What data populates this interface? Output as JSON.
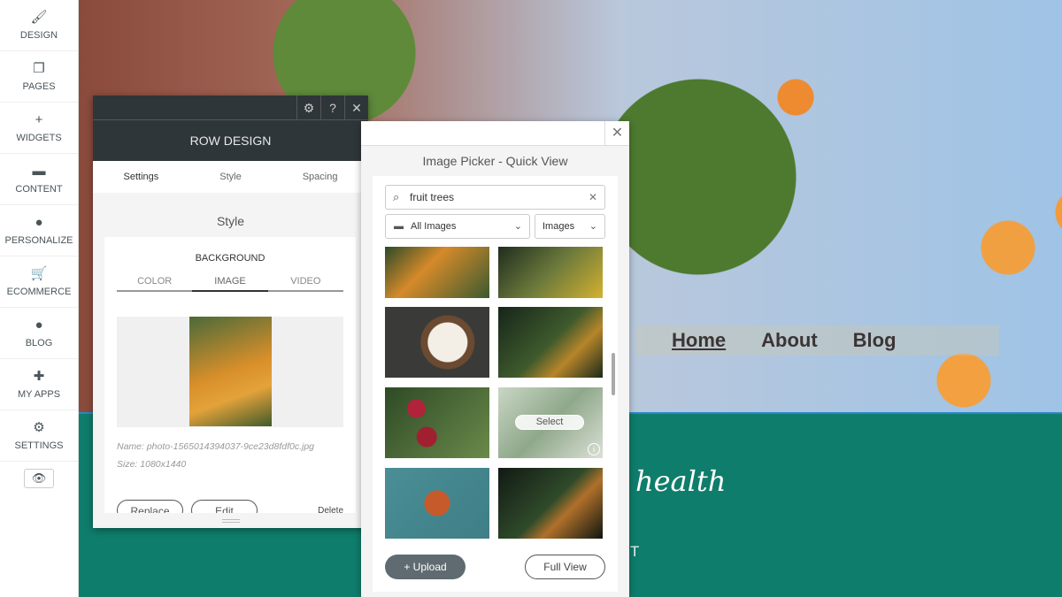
{
  "sidebar": {
    "items": [
      {
        "label": "DESIGN",
        "icon": "brush-icon",
        "glyph": "🖌"
      },
      {
        "label": "PAGES",
        "icon": "pages-icon",
        "glyph": "❐"
      },
      {
        "label": "WIDGETS",
        "icon": "plus-icon",
        "glyph": "+"
      },
      {
        "label": "CONTENT",
        "icon": "folder-icon",
        "glyph": "▬"
      },
      {
        "label": "PERSONALIZE",
        "icon": "person-icon",
        "glyph": "●"
      },
      {
        "label": "ECOMMERCE",
        "icon": "cart-icon",
        "glyph": "🛒"
      },
      {
        "label": "BLOG",
        "icon": "chat-bubble-icon",
        "glyph": "●"
      },
      {
        "label": "MY APPS",
        "icon": "puzzle-icon",
        "glyph": "✚"
      },
      {
        "label": "SETTINGS",
        "icon": "gear-icon",
        "glyph": "⚙"
      }
    ],
    "preview_glyph": "👁"
  },
  "site": {
    "nav": [
      "Home",
      "About",
      "Blog"
    ],
    "headline_fragment": "health",
    "subtext_fragment": "T",
    "teal": "#0f7d6b"
  },
  "row_design": {
    "gear": "⚙",
    "help": "?",
    "close": "✕",
    "title": "ROW DESIGN",
    "tabs": [
      "Settings",
      "Style",
      "Spacing"
    ],
    "section": "Style",
    "background": {
      "heading": "BACKGROUND",
      "tabs": [
        "COLOR",
        "IMAGE",
        "VIDEO"
      ],
      "active_tab": "IMAGE",
      "name": "Name: photo-1565014394037-9ce23d8fdf0c.jpg",
      "size": "Size: 1080x1440",
      "replace": "Replace",
      "edit": "Edit",
      "delete": "Delete"
    }
  },
  "image_picker": {
    "close": "✕",
    "title": "Image Picker - Quick View",
    "search_value": "fruit trees",
    "search_icon": "⌕",
    "clear": "✕",
    "folder_select": "All Images",
    "type_select": "Images",
    "chevron": "⌄",
    "select_label": "Select",
    "info": "i",
    "upload": "+  Upload",
    "full_view": "Full View"
  }
}
